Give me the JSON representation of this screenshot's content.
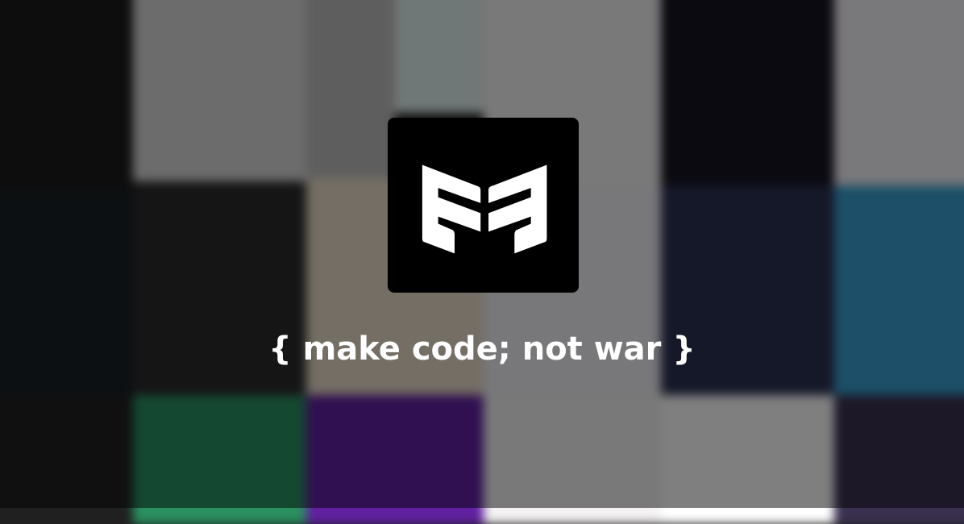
{
  "tagline": "{ make code; not war }",
  "logo": {
    "icon": "ff-monogram-logo",
    "background": "#000000",
    "foreground": "#ffffff"
  },
  "background_tiles": [
    "#1b1b1b",
    "#d8d8d8",
    "#bdbdbd",
    "#dfeeee",
    "#f2f2f2",
    "#151520",
    "#f3f0f4",
    "#1a2024",
    "#2a2a2c",
    "#e8ddc8",
    "#f0f0f4",
    "#2a3050",
    "#3aa0d0",
    "#202020",
    "#2a9060",
    "#6020a0",
    "#f4f2f2",
    "#ffffff",
    "#3a3050"
  ]
}
